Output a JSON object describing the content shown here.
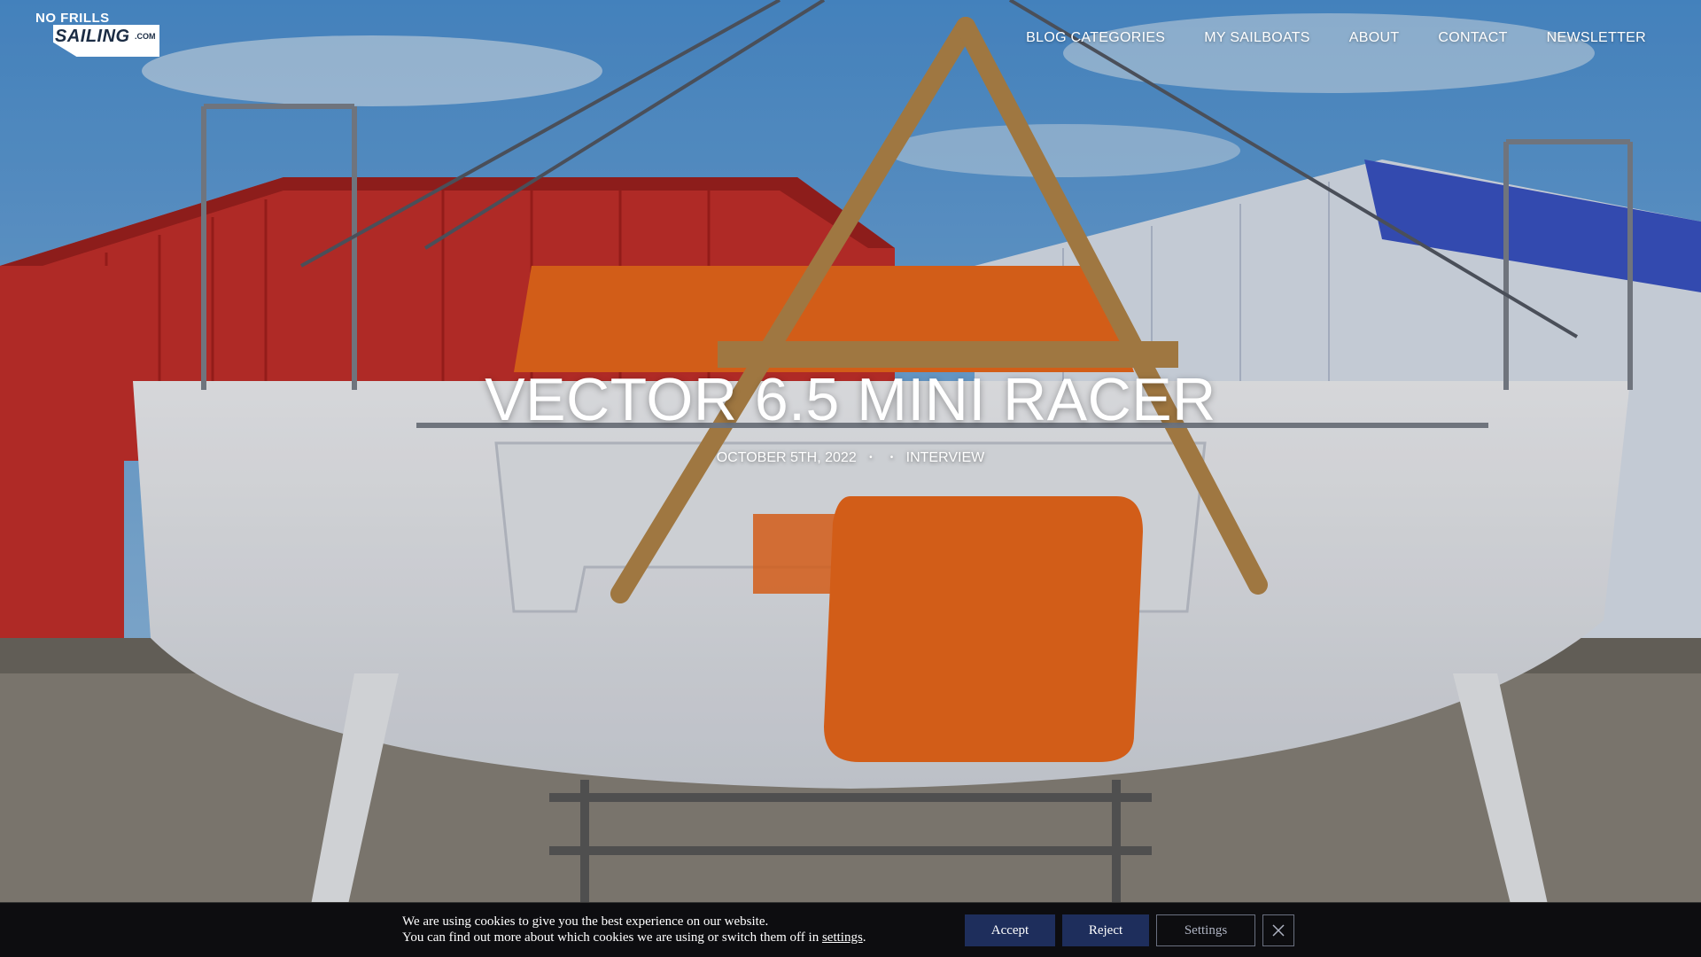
{
  "header": {
    "logo_top": "NO FRILLS",
    "logo_main": "SAILING",
    "logo_suffix": ".COM",
    "nav": [
      {
        "label": "BLOG CATEGORIES"
      },
      {
        "label": "MY SAILBOATS"
      },
      {
        "label": "ABOUT"
      },
      {
        "label": "CONTACT"
      },
      {
        "label": "NEWSLETTER"
      }
    ]
  },
  "post": {
    "title": "VECTOR 6.5 MINI RACER",
    "date": "OCTOBER 5TH, 2022",
    "category": "INTERVIEW"
  },
  "cookie": {
    "line1": "We are using cookies to give you the best experience on our website.",
    "line2_prefix": "You can find out more about which cookies we are using or switch them off in ",
    "settings_link": "settings",
    "line2_suffix": ".",
    "accept_label": "Accept",
    "reject_label": "Reject",
    "settings_label": "Settings",
    "close_icon": "close-icon"
  },
  "colors": {
    "cookie_bg": "#0d0d10",
    "button_primary": "#1e2e5c",
    "hull_orange": "#f06a1c"
  }
}
